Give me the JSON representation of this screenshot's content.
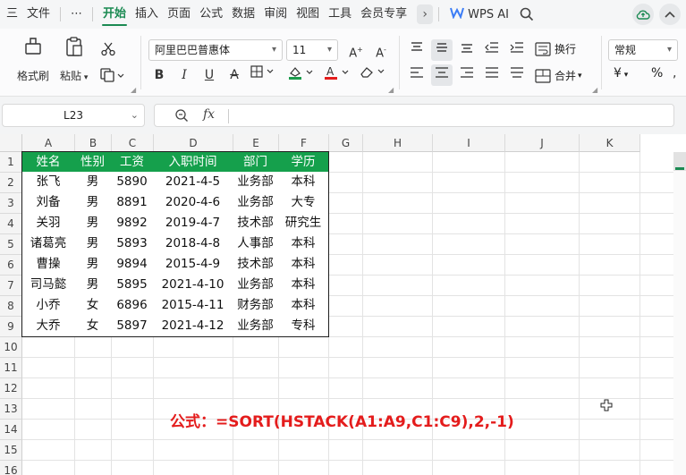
{
  "menu": {
    "hamburger": "三",
    "file": "文件",
    "more": "⋯",
    "tabs": [
      "开始",
      "插入",
      "页面",
      "公式",
      "数据",
      "审阅",
      "视图",
      "工具",
      "会员专享"
    ],
    "active_tab": "开始",
    "wps_ai": "WPS AI"
  },
  "ribbon": {
    "format_painter": "格式刷",
    "paste": "粘贴",
    "font_name": "阿里巴巴普惠体",
    "font_size": "11",
    "wrap": "换行",
    "merge": "合并",
    "number_format": "常规",
    "currency": "¥",
    "percent": "%"
  },
  "formula_bar": {
    "cell_ref": "L23",
    "fx": "fx",
    "formula": ""
  },
  "grid": {
    "columns": [
      "A",
      "B",
      "C",
      "D",
      "E",
      "F",
      "G",
      "H",
      "I",
      "J",
      "K"
    ],
    "rows": [
      "1",
      "2",
      "3",
      "4",
      "5",
      "6",
      "7",
      "8",
      "9",
      "10",
      "11",
      "12",
      "13",
      "14",
      "15",
      "16"
    ],
    "table_header": [
      "姓名",
      "性别",
      "工资",
      "入职时间",
      "部门",
      "学历"
    ],
    "table_rows": [
      [
        "张飞",
        "男",
        "5890",
        "2021-4-5",
        "业务部",
        "本科"
      ],
      [
        "刘备",
        "男",
        "8891",
        "2020-4-6",
        "业务部",
        "大专"
      ],
      [
        "关羽",
        "男",
        "9892",
        "2019-4-7",
        "技术部",
        "研究生"
      ],
      [
        "诸葛亮",
        "男",
        "5893",
        "2018-4-8",
        "人事部",
        "本科"
      ],
      [
        "曹操",
        "男",
        "9894",
        "2015-4-9",
        "技术部",
        "本科"
      ],
      [
        "司马懿",
        "男",
        "5895",
        "2021-4-10",
        "业务部",
        "本科"
      ],
      [
        "小乔",
        "女",
        "6896",
        "2015-4-11",
        "财务部",
        "本科"
      ],
      [
        "大乔",
        "女",
        "5897",
        "2021-4-12",
        "业务部",
        "专科"
      ]
    ],
    "formula_note": "公式：=SORT(HSTACK(A1:A9,C1:C9),2,-1)"
  },
  "colors": {
    "header_fill": "#15a04c",
    "accent": "#1a8a52",
    "note": "#e41c1c"
  }
}
